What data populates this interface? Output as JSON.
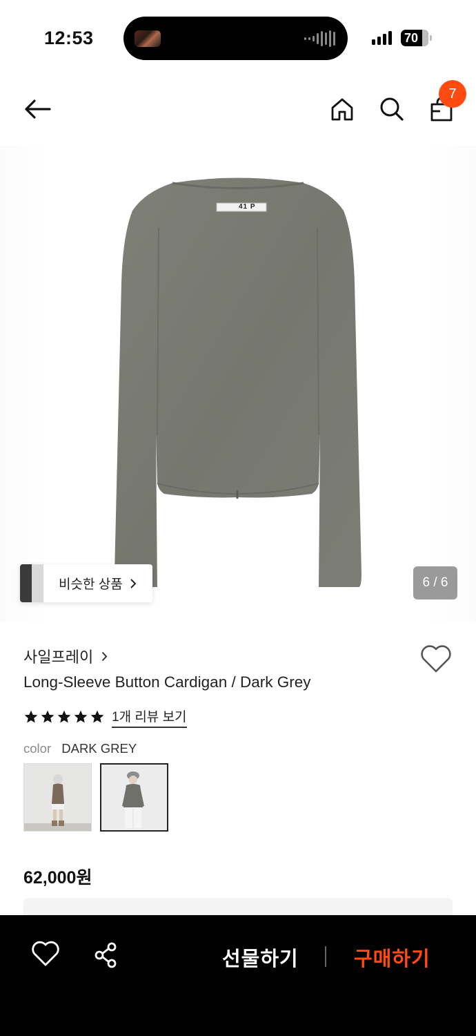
{
  "status_bar": {
    "time": "12:53",
    "battery": "70"
  },
  "header": {
    "back_icon": "arrow-left-icon",
    "home_icon": "home-icon",
    "search_icon": "search-icon",
    "bag_icon": "shopping-bag-icon",
    "bag_badge": "7"
  },
  "gallery": {
    "tag_text": "41 P",
    "similar_label": "비슷한 상품",
    "page_indicator": "6 / 6"
  },
  "product": {
    "brand": "사일프레이",
    "title": "Long-Sleeve Button Cardigan / Dark Grey",
    "rating_stars": 5,
    "review_link": "1개 리뷰 보기",
    "color_label": "color",
    "color_value": "DARK GREY",
    "price": "62,000원"
  },
  "bottom_bar": {
    "gift_label": "선물하기",
    "buy_label": "구매하기"
  },
  "colors": {
    "accent": "#ff4b12",
    "garment": "#7a7b72",
    "bottom_bar": "#000000"
  }
}
